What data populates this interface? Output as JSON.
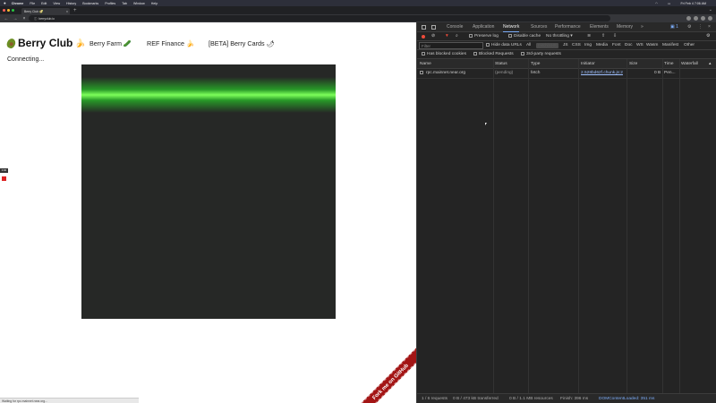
{
  "menubar": {
    "apple": "",
    "items": [
      "Chrome",
      "File",
      "Edit",
      "View",
      "History",
      "Bookmarks",
      "Profiles",
      "Tab",
      "Window",
      "Help"
    ],
    "clock": "Fri Feb 4  7:06 AM"
  },
  "browser": {
    "tab_title": "Berry Club 🥑",
    "url": "berryclub.io",
    "traffic_colors": [
      "#ff5f57",
      "#febc2e",
      "#28c840"
    ]
  },
  "page": {
    "title": "Berry Club",
    "nav": [
      "Berry Farm 🥒",
      "REF Finance 🍌",
      "[BETA] Berry Cards 🌶"
    ],
    "status": "Connecting...",
    "side_badge": "0:00",
    "ribbon": "Fork me on GitHub",
    "statusbar": "Waiting for rpc.mainnet.near.org...",
    "colors": {
      "glow": "#7dff5a",
      "board": "#262826",
      "ribbon": "#a31515"
    }
  },
  "devtools": {
    "tabs": [
      "Console",
      "Application",
      "Network",
      "Sources",
      "Performance",
      "Elements",
      "Memory"
    ],
    "active_tab": "Network",
    "overflow": "»",
    "issues_count": "1",
    "toolbar": {
      "preserve_log": "Preserve log",
      "disable_cache": "Disable cache",
      "throttling": "No throttling"
    },
    "filter": {
      "placeholder": "Filter",
      "hide_data_urls": "Hide data URLs",
      "types": [
        "All",
        "Fetch/XHR",
        "JS",
        "CSS",
        "Img",
        "Media",
        "Font",
        "Doc",
        "WS",
        "Wasm",
        "Manifest",
        "Other"
      ]
    },
    "checkboxes": [
      "Has blocked cookies",
      "Blocked Requests",
      "3rd-party requests"
    ],
    "columns": [
      "Name",
      "Status",
      "Type",
      "Initiator",
      "Size",
      "Time",
      "Waterfall"
    ],
    "rows": [
      {
        "name": "rpc.mainnet.near.org",
        "status": "(pending)",
        "type": "fetch",
        "initiator": "2.528bd62f.chunk.js:2",
        "size": "0 B",
        "time": "Pen..."
      }
    ],
    "footer": {
      "requests": "1 / 6 requests",
      "transferred": "0 B / 473 kB transferred",
      "resources": "0 B / 1.1 MB resources",
      "finish": "Finish: 396 ms",
      "dcl": "DOMContentLoaded: 351 ms"
    }
  }
}
